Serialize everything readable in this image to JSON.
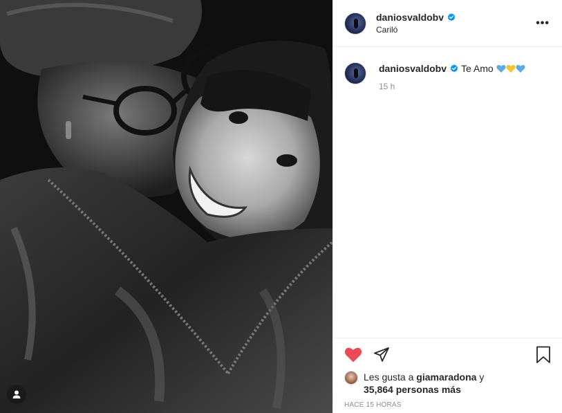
{
  "post": {
    "username": "daniosvaldobv",
    "location": "Cariló",
    "more_label": "•••"
  },
  "caption": {
    "username": "daniosvaldobv",
    "text": "Te Amo",
    "emoji_hearts": [
      "blue-heart",
      "yellow-heart",
      "blue-heart"
    ],
    "time": "15 h"
  },
  "likes": {
    "prefix": "Les gusta a",
    "first_liker": "giamaradona",
    "joiner": "y",
    "others": "35,864 personas más"
  },
  "timestamp": "HACE 15 HORAS",
  "colors": {
    "like_heart": "#ed4956",
    "verified": "#0095f6",
    "heart_blue": "#5dade2",
    "heart_yellow": "#f4c430"
  }
}
